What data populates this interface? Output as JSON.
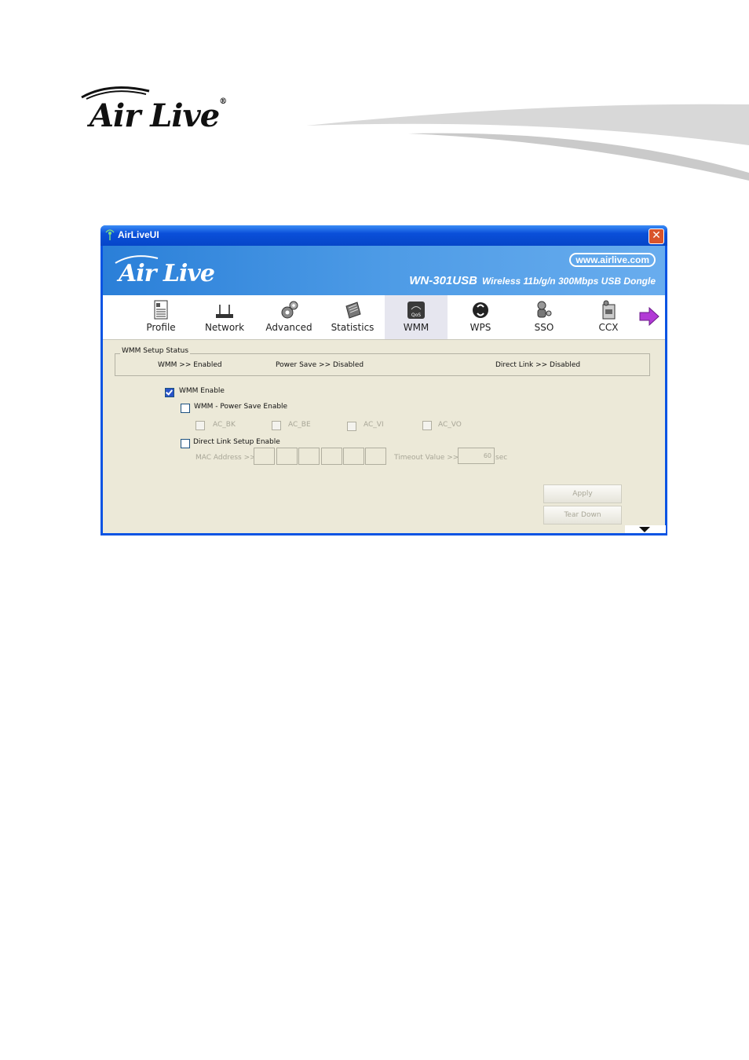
{
  "page_logo": {
    "text": "Air Live",
    "reg": "®"
  },
  "window": {
    "title": "AirLiveUI",
    "close": "✕",
    "banner": {
      "logo": "Air Live",
      "url": "www.airlive.com",
      "model": "WN-301USB",
      "description": "Wireless 11b/g/n 300Mbps USB Dongle"
    },
    "toolbar": [
      {
        "label": "Profile",
        "icon": "profile-icon"
      },
      {
        "label": "Network",
        "icon": "network-icon"
      },
      {
        "label": "Advanced",
        "icon": "advanced-icon"
      },
      {
        "label": "Statistics",
        "icon": "statistics-icon"
      },
      {
        "label": "WMM",
        "icon": "qos-icon",
        "active": true
      },
      {
        "label": "WPS",
        "icon": "wps-icon"
      },
      {
        "label": "SSO",
        "icon": "sso-icon"
      },
      {
        "label": "CCX",
        "icon": "ccx-icon"
      }
    ],
    "status": {
      "legend": "WMM Setup Status",
      "wmm": "WMM >> Enabled",
      "power_save": "Power Save >> Disabled",
      "direct_link": "Direct Link >> Disabled"
    },
    "options": {
      "wmm_enable": "WMM Enable",
      "power_save_enable": "WMM - Power Save Enable",
      "ac_bk": "AC_BK",
      "ac_be": "AC_BE",
      "ac_vi": "AC_VI",
      "ac_vo": "AC_VO",
      "direct_link_enable": "Direct Link Setup Enable",
      "mac_address": "MAC Address >>",
      "timeout_label": "Timeout Value >>",
      "timeout_value": "60",
      "timeout_unit": "sec"
    },
    "buttons": {
      "apply": "Apply",
      "tear_down": "Tear Down"
    },
    "colors": {
      "titlebar": "#0a54e3",
      "banner": "#3a8de0",
      "active_tab": "#e6e6ef"
    }
  }
}
